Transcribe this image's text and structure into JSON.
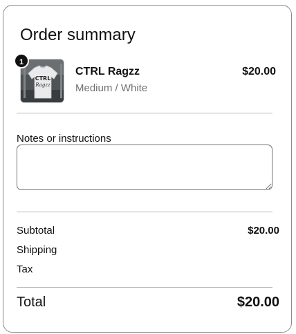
{
  "summary": {
    "title": "Order summary"
  },
  "line_item": {
    "quantity": "1",
    "name": "CTRL Ragzz",
    "variant": "Medium / White",
    "price": "$20.00",
    "image_icon": "tshirt-product-image",
    "image_text": "CTRL Ragzz"
  },
  "notes": {
    "label": "Notes or instructions",
    "value": "",
    "placeholder": ""
  },
  "totals": {
    "subtotal_label": "Subtotal",
    "subtotal_value": "$20.00",
    "shipping_label": "Shipping",
    "tax_label": "Tax",
    "total_label": "Total",
    "total_value": "$20.00"
  },
  "colors": {
    "text": "#111111",
    "muted": "#707070",
    "border": "#8a8a8a",
    "badge": "#111111"
  }
}
